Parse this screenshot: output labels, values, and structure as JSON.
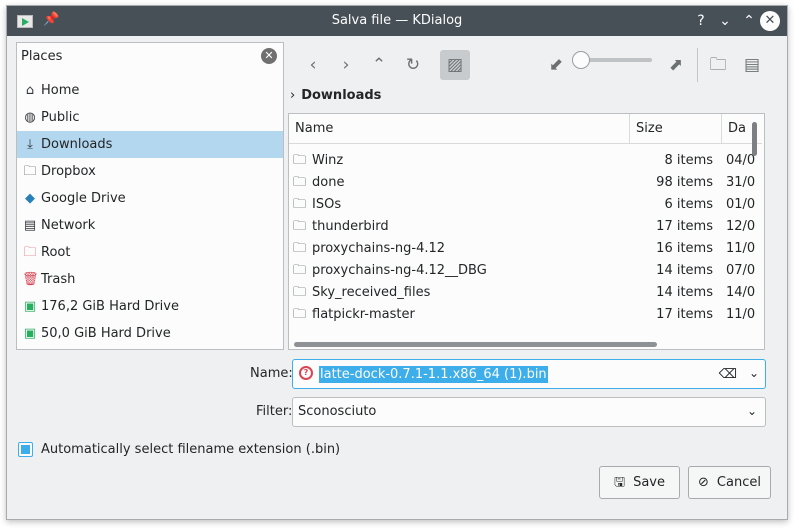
{
  "window": {
    "title": "Salva file — KDialog",
    "buttons": {
      "help": "?",
      "minimize": "⌄",
      "maximize": "⌃",
      "close": "✕"
    }
  },
  "places": {
    "header": "Places",
    "items": [
      {
        "label": "Home",
        "icon": "home-icon"
      },
      {
        "label": "Public",
        "icon": "globe-icon"
      },
      {
        "label": "Downloads",
        "icon": "download-icon",
        "selected": true
      },
      {
        "label": "Dropbox",
        "icon": "folder-icon"
      },
      {
        "label": "Google Drive",
        "icon": "google-drive-icon"
      },
      {
        "label": "Network",
        "icon": "network-icon"
      },
      {
        "label": "Root",
        "icon": "root-folder-icon"
      },
      {
        "label": "Trash",
        "icon": "trash-icon"
      },
      {
        "label": "176,2 GiB Hard Drive",
        "icon": "hard-drive-icon"
      },
      {
        "label": "50,0 GiB Hard Drive",
        "icon": "hard-drive-icon"
      }
    ]
  },
  "breadcrumb": {
    "current": "Downloads"
  },
  "filelist": {
    "columns": {
      "name": "Name",
      "size": "Size",
      "date": "Da"
    },
    "rows": [
      {
        "name": "Winz",
        "size": "8 items",
        "date": "04/0"
      },
      {
        "name": "done",
        "size": "98 items",
        "date": "31/0"
      },
      {
        "name": "ISOs",
        "size": "6 items",
        "date": "01/0"
      },
      {
        "name": "thunderbird",
        "size": "17 items",
        "date": "12/0"
      },
      {
        "name": "proxychains-ng-4.12",
        "size": "16 items",
        "date": "11/0"
      },
      {
        "name": "proxychains-ng-4.12__DBG",
        "size": "14 items",
        "date": "07/0"
      },
      {
        "name": "Sky_received_files",
        "size": "14 items",
        "date": "14/0"
      },
      {
        "name": "flatpickr-master",
        "size": "17 items",
        "date": "11/0"
      }
    ]
  },
  "form": {
    "name_label": "Name:",
    "name_value": "latte-dock-0.7.1-1.1.x86_64 (1).bin",
    "filter_label": "Filter:",
    "filter_value": "Sconosciuto",
    "auto_ext_label": "Automatically select filename extension (.bin)"
  },
  "buttons": {
    "save": "Save",
    "cancel": "Cancel"
  },
  "colors": {
    "accent": "#3daee9",
    "titlebar": "#475057",
    "selection": "#b4d7f0"
  }
}
